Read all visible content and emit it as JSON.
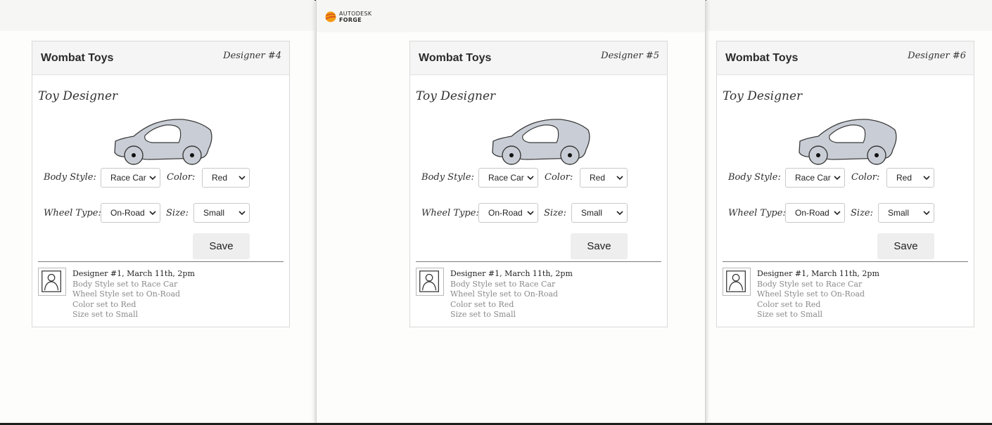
{
  "logo": {
    "line1": "AUTODESK",
    "line2": "FORGE"
  },
  "panels": [
    {
      "brand": "Wombat Toys",
      "designer": "Designer #4",
      "title": "Toy Designer",
      "body_style_label": "Body Style:",
      "body_style_value": "Race Car",
      "color_label": "Color:",
      "color_value": "Red",
      "wheel_type_label": "Wheel Type:",
      "wheel_type_value": "On-Road",
      "size_label": "Size:",
      "size_value": "Small",
      "save_label": "Save",
      "history": {
        "header": "Designer #1, March 11th, 2pm",
        "entries": [
          "Body Style set to Race Car",
          "Wheel Style set to On-Road",
          "Color set to Red",
          "Size set to Small"
        ]
      }
    },
    {
      "brand": "Wombat Toys",
      "designer": "Designer #5",
      "title": "Toy Designer",
      "body_style_label": "Body Style:",
      "body_style_value": "Race Car",
      "color_label": "Color:",
      "color_value": "Red",
      "wheel_type_label": "Wheel Type:",
      "wheel_type_value": "On-Road",
      "size_label": "Size:",
      "size_value": "Small",
      "save_label": "Save",
      "history": {
        "header": "Designer #1, March 11th, 2pm",
        "entries": [
          "Body Style set to Race Car",
          "Wheel Style set to On-Road",
          "Color set to Red",
          "Size set to Small"
        ]
      }
    },
    {
      "brand": "Wombat Toys",
      "designer": "Designer #6",
      "title": "Toy Designer",
      "body_style_label": "Body Style:",
      "body_style_value": "Race Car",
      "color_label": "Color:",
      "color_value": "Red",
      "wheel_type_label": "Wheel Type:",
      "wheel_type_value": "On-Road",
      "size_label": "Size:",
      "size_value": "Small",
      "save_label": "Save",
      "history": {
        "header": "Designer #1, March 11th, 2pm",
        "entries": [
          "Body Style set to Race Car",
          "Wheel Style set to On-Road",
          "Color set to Red",
          "Size set to Small"
        ]
      }
    }
  ],
  "colors": {
    "car_body": "#c9ced6",
    "logo_orange": "#f39c12",
    "logo_red": "#d9541e"
  },
  "icons": {
    "car": "race-car-sketch",
    "avatar": "user-avatar",
    "select": "chevron-down-icon"
  }
}
